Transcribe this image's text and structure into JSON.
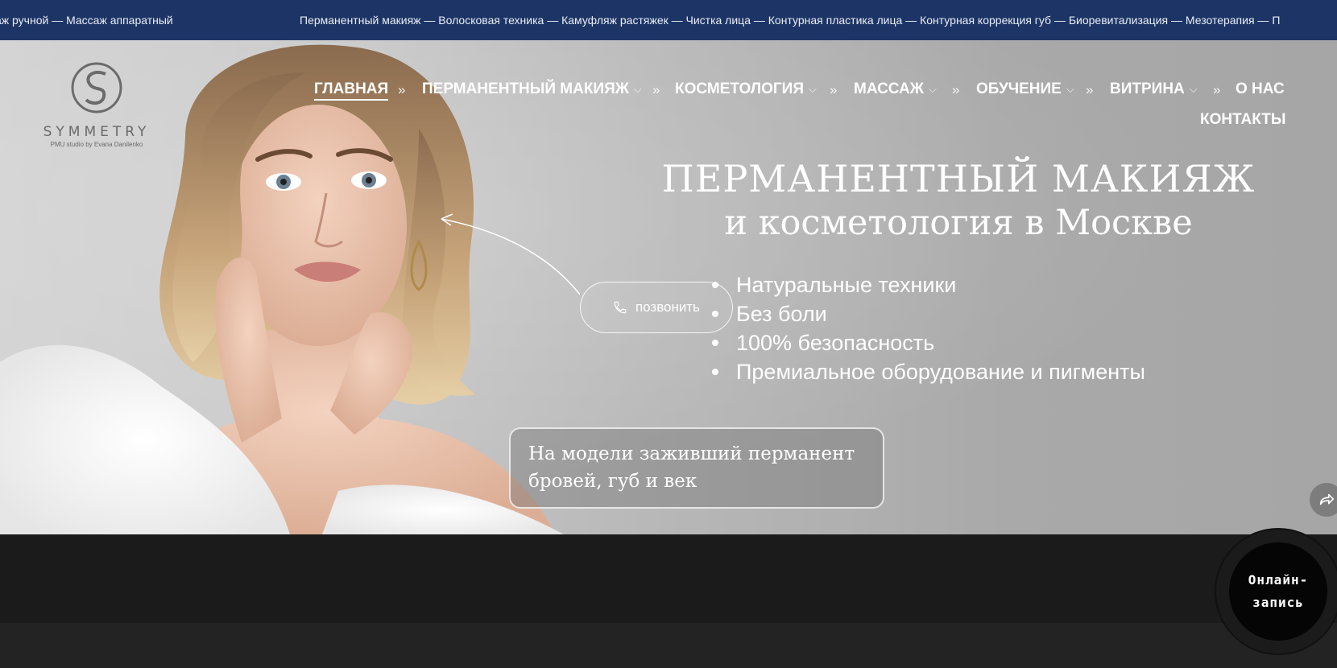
{
  "ticker": {
    "left_text": "аж ручной — Массаж аппаратный",
    "main_text": "Перманентный макияж — Волосковая техника — Камуфляж растяжек — Чистка лица — Контурная пластика лица — Контурная коррекция губ — Биоревитализация — Мезотерапия — П"
  },
  "logo": {
    "icon": "symmetry-s-logo",
    "name": "SYMMETRY",
    "tagline": "PMU studio by Evana Danilenko"
  },
  "nav": {
    "separator": "»",
    "items": [
      {
        "label": "ГЛАВНАЯ",
        "has_dropdown": false,
        "active": true
      },
      {
        "label": "ПЕРМАНЕНТНЫЙ МАКИЯЖ",
        "has_dropdown": true
      },
      {
        "label": "КОСМЕТОЛОГИЯ",
        "has_dropdown": true
      },
      {
        "label": "МАССАЖ",
        "has_dropdown": true
      },
      {
        "label": "ОБУЧЕНИЕ",
        "has_dropdown": true
      },
      {
        "label": "ВИТРИНА",
        "has_dropdown": true
      },
      {
        "label": "О НАС",
        "has_dropdown": false
      },
      {
        "label": "КОНТАКТЫ",
        "has_dropdown": false
      }
    ],
    "chevron_icon": "chevron-down-icon"
  },
  "hero": {
    "title_line1": "ПЕРМАНЕНТНЫЙ МАКИЯЖ",
    "title_line2": "и косметология в Москве",
    "bullets": [
      "Натуральные техники",
      "Без боли",
      "100% безопасность",
      "Премиальное оборудование и пигменты"
    ],
    "call_button": "позвонить",
    "caption": "На модели заживший перманент бровей, губ и век"
  },
  "booking": {
    "label_line1": "Онлайн-",
    "label_line2": "запись"
  },
  "colors": {
    "ticker_bg": "#1d3566",
    "dark_bg": "#1b1b1b",
    "text": "#ffffff"
  }
}
